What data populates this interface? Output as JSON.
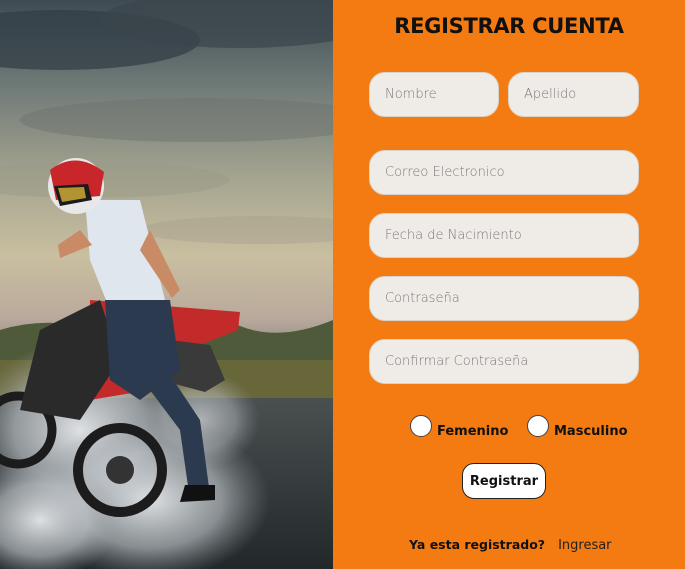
{
  "form": {
    "title": "REGISTRAR CUENTA",
    "fields": {
      "first_name": {
        "placeholder": "Nombre",
        "value": ""
      },
      "last_name": {
        "placeholder": "Apellido",
        "value": ""
      },
      "email": {
        "placeholder": "Correo Electronico",
        "value": ""
      },
      "birth_date": {
        "placeholder": "Fecha de Nacimiento",
        "value": ""
      },
      "password": {
        "placeholder": "Contraseña",
        "value": ""
      },
      "confirm_password": {
        "placeholder": "Confirmar Contraseña",
        "value": ""
      }
    },
    "gender": {
      "options": [
        "Femenino",
        "Masculino"
      ],
      "selected": ""
    },
    "submit_label": "Registrar",
    "footer": {
      "question": "Ya esta registrado?",
      "login_link": "Ingresar"
    }
  },
  "image": {
    "subject": "motorcycle-stunt-photo"
  },
  "colors": {
    "panel_bg": "#f47a12",
    "field_bg": "#efebe6"
  }
}
